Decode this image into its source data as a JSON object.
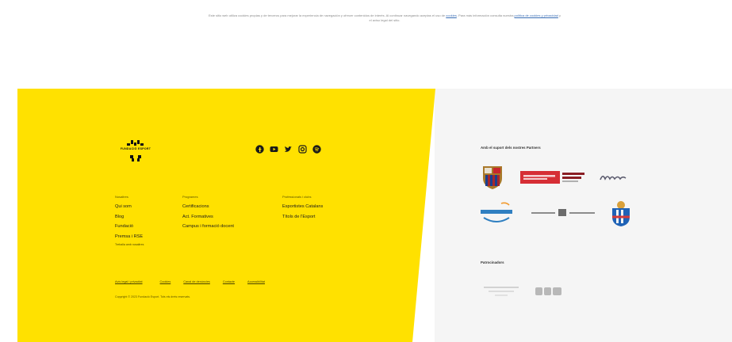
{
  "notice": {
    "text_before": "Este sitio web utiliza cookies propias y de terceros para mejorar la experiencia de navegación y ofrecer contenidos de interés. Al continuar navegando aceptas el uso de",
    "link1": "cookies",
    "text_mid": ". Para más información consulta nuestra",
    "link2": "política de cookies y privacidad",
    "text_after": "y el aviso legal del sitio."
  },
  "footer": {
    "logo_icon": "brand-logo-icon",
    "logo_text": "FUNDACIÓ ESPORT",
    "social": [
      "facebook-icon",
      "youtube-icon",
      "twitter-icon",
      "instagram-icon",
      "spotify-icon"
    ],
    "columns": [
      {
        "head": "Nosaltres",
        "items": [
          "Qui som",
          "Blog",
          "Fundació",
          "Premsa i RSE"
        ],
        "small": "Treballa amb nosaltres"
      },
      {
        "head": "Programes",
        "items": [
          "Certificacions",
          "Act. Formatives",
          "Campus i formació docent"
        ]
      },
      {
        "head": "Professionals i clubs",
        "items": [
          "Esportistes Catalans",
          "Títols de l'Esport"
        ]
      }
    ],
    "legal": [
      "Avís legal i privacitat",
      "Cookies",
      "Canal de denúncies",
      "Contacte",
      "Accessibilitat"
    ],
    "copyright": "Copyright © 2023 Fundació Esport. Tots els drets reservats."
  },
  "partners": {
    "title": "Amb el suport dels nostres Partners",
    "sponsors_title": "Patrocinadors"
  }
}
